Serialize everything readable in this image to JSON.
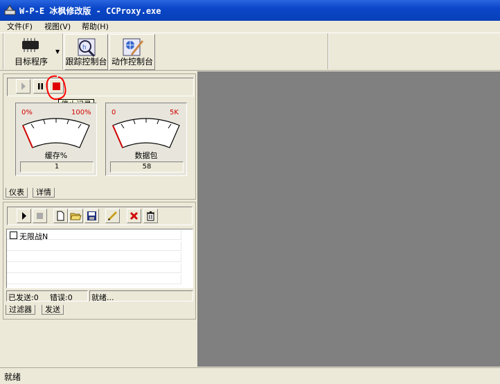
{
  "window": {
    "title": "W-P-E 冰枫修改版 - CCProxy.exe"
  },
  "menu": {
    "items": [
      "文件(F)",
      "视图(V)",
      "帮助(H)"
    ]
  },
  "toolbar": {
    "target_label": "目标程序",
    "trace_label": "跟踪控制台",
    "action_label": "动作控制台"
  },
  "record_controls": {
    "tooltip": "停止记录"
  },
  "gauges": {
    "buffer": {
      "min": "0%",
      "max": "100%",
      "label": "缓存%",
      "value": "1"
    },
    "packets": {
      "min": "0",
      "max": "5K",
      "label": "数据包",
      "value": "58"
    }
  },
  "top_tabs": [
    "仪表",
    "详情"
  ],
  "filter_list": {
    "items": [
      "无限战N"
    ]
  },
  "filter_status": {
    "sent": "已发送:0",
    "errors": "错误:0",
    "state": "就绪..."
  },
  "bottom_tabs": [
    "过滤器",
    "发送"
  ],
  "status": {
    "text": "就绪"
  },
  "colors": {
    "title_bar": "#0a46c8",
    "workspace": "#808080",
    "gauge_scale": "#d00000",
    "annotation": "#ff0000"
  }
}
